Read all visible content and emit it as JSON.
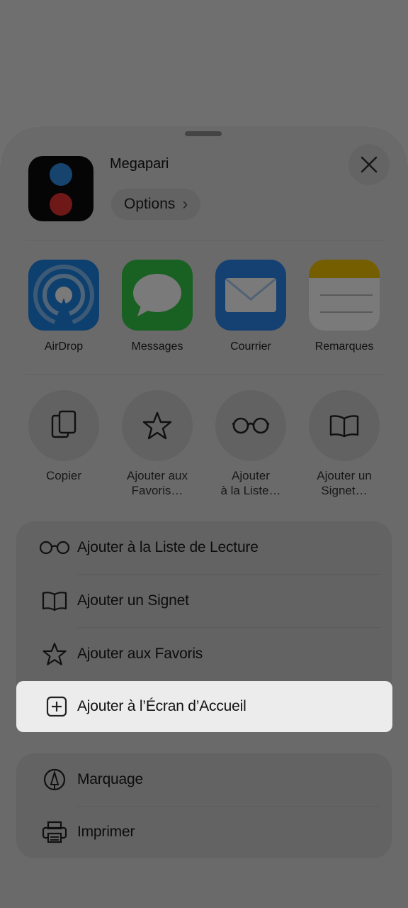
{
  "header": {
    "app_name": "Megapari",
    "options_label": "Options",
    "options_chevron": "›"
  },
  "share_targets": [
    {
      "label": "AirDrop",
      "icon": "airdrop-icon"
    },
    {
      "label": "Messages",
      "icon": "messages-icon"
    },
    {
      "label": "Courrier",
      "icon": "mail-icon"
    },
    {
      "label": "Remarques",
      "icon": "notes-icon"
    }
  ],
  "quick_actions": [
    {
      "label": "Copier",
      "icon": "copy-icon"
    },
    {
      "label": "Ajouter aux\nFavoris…",
      "icon": "star-icon"
    },
    {
      "label": "Ajouter\nà la Liste…",
      "icon": "glasses-icon"
    },
    {
      "label": "Ajouter un\nSignet…",
      "icon": "book-icon"
    }
  ],
  "menu_group_1": [
    {
      "label": "Ajouter à la Liste de Lecture",
      "icon": "glasses-icon"
    },
    {
      "label": "Ajouter un Signet",
      "icon": "book-icon"
    },
    {
      "label": "Ajouter aux Favoris",
      "icon": "star-icon"
    },
    {
      "label": "Ajouter à l’Écran d’Accueil",
      "icon": "add-square-icon",
      "highlighted": true
    }
  ],
  "menu_group_2": [
    {
      "label": "Marquage",
      "icon": "markup-icon"
    },
    {
      "label": "Imprimer",
      "icon": "printer-icon"
    }
  ],
  "colors": {
    "airdrop": "#1f86e8",
    "messages": "#35c84a",
    "mail": "#2a86ee",
    "notes_top": "#f5c400",
    "app_blue_dot": "#2f8fe6",
    "app_red_dot": "#e53232"
  }
}
